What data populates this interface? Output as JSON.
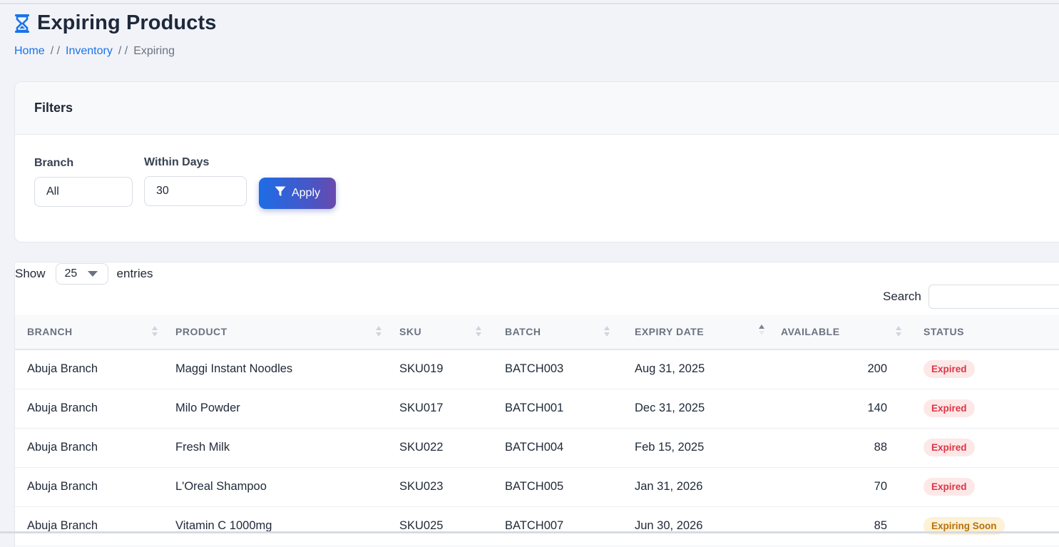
{
  "page": {
    "title": "Expiring Products",
    "icon": "hourglass-icon",
    "breadcrumb": [
      {
        "label": "Home",
        "separator": "/ /"
      },
      {
        "label": "Inventory",
        "separator": "/ /"
      },
      {
        "label": "Expiring"
      }
    ]
  },
  "filters": {
    "header": "Filters",
    "branch": {
      "label": "Branch",
      "value": "All"
    },
    "within_days": {
      "label": "Within Days",
      "value": "30"
    },
    "apply_label": "Apply"
  },
  "table_controls": {
    "show_label": "Show",
    "entries_value": "25",
    "entries_label": "entries",
    "search_label": "Search",
    "search_value": ""
  },
  "table": {
    "columns": [
      "BRANCH",
      "PRODUCT",
      "SKU",
      "BATCH",
      "EXPIRY DATE",
      "AVAILABLE",
      "STATUS"
    ],
    "sorted_column": "EXPIRY DATE",
    "sort_direction": "ascending",
    "rows": [
      {
        "branch": "Abuja Branch",
        "product": "Maggi Instant Noodles",
        "sku": "SKU019",
        "batch": "BATCH003",
        "expiry": "Aug 31, 2025",
        "available": "200",
        "status": "Expired"
      },
      {
        "branch": "Abuja Branch",
        "product": "Milo Powder",
        "sku": "SKU017",
        "batch": "BATCH001",
        "expiry": "Dec 31, 2025",
        "available": "140",
        "status": "Expired"
      },
      {
        "branch": "Abuja Branch",
        "product": "Fresh Milk",
        "sku": "SKU022",
        "batch": "BATCH004",
        "expiry": "Feb 15, 2025",
        "available": "88",
        "status": "Expired"
      },
      {
        "branch": "Abuja Branch",
        "product": "L'Oreal Shampoo",
        "sku": "SKU023",
        "batch": "BATCH005",
        "expiry": "Jan 31, 2026",
        "available": "70",
        "status": "Expired"
      },
      {
        "branch": "Abuja Branch",
        "product": "Vitamin C 1000mg",
        "sku": "SKU025",
        "batch": "BATCH007",
        "expiry": "Jun 30, 2026",
        "available": "85",
        "status": "Expiring Soon"
      }
    ]
  },
  "colors": {
    "accent": "#1a73e8",
    "expired_text": "#dc3545",
    "expired_bg": "#fde8e8",
    "soon_text": "#b6700a",
    "soon_bg": "#fdf1d6"
  }
}
